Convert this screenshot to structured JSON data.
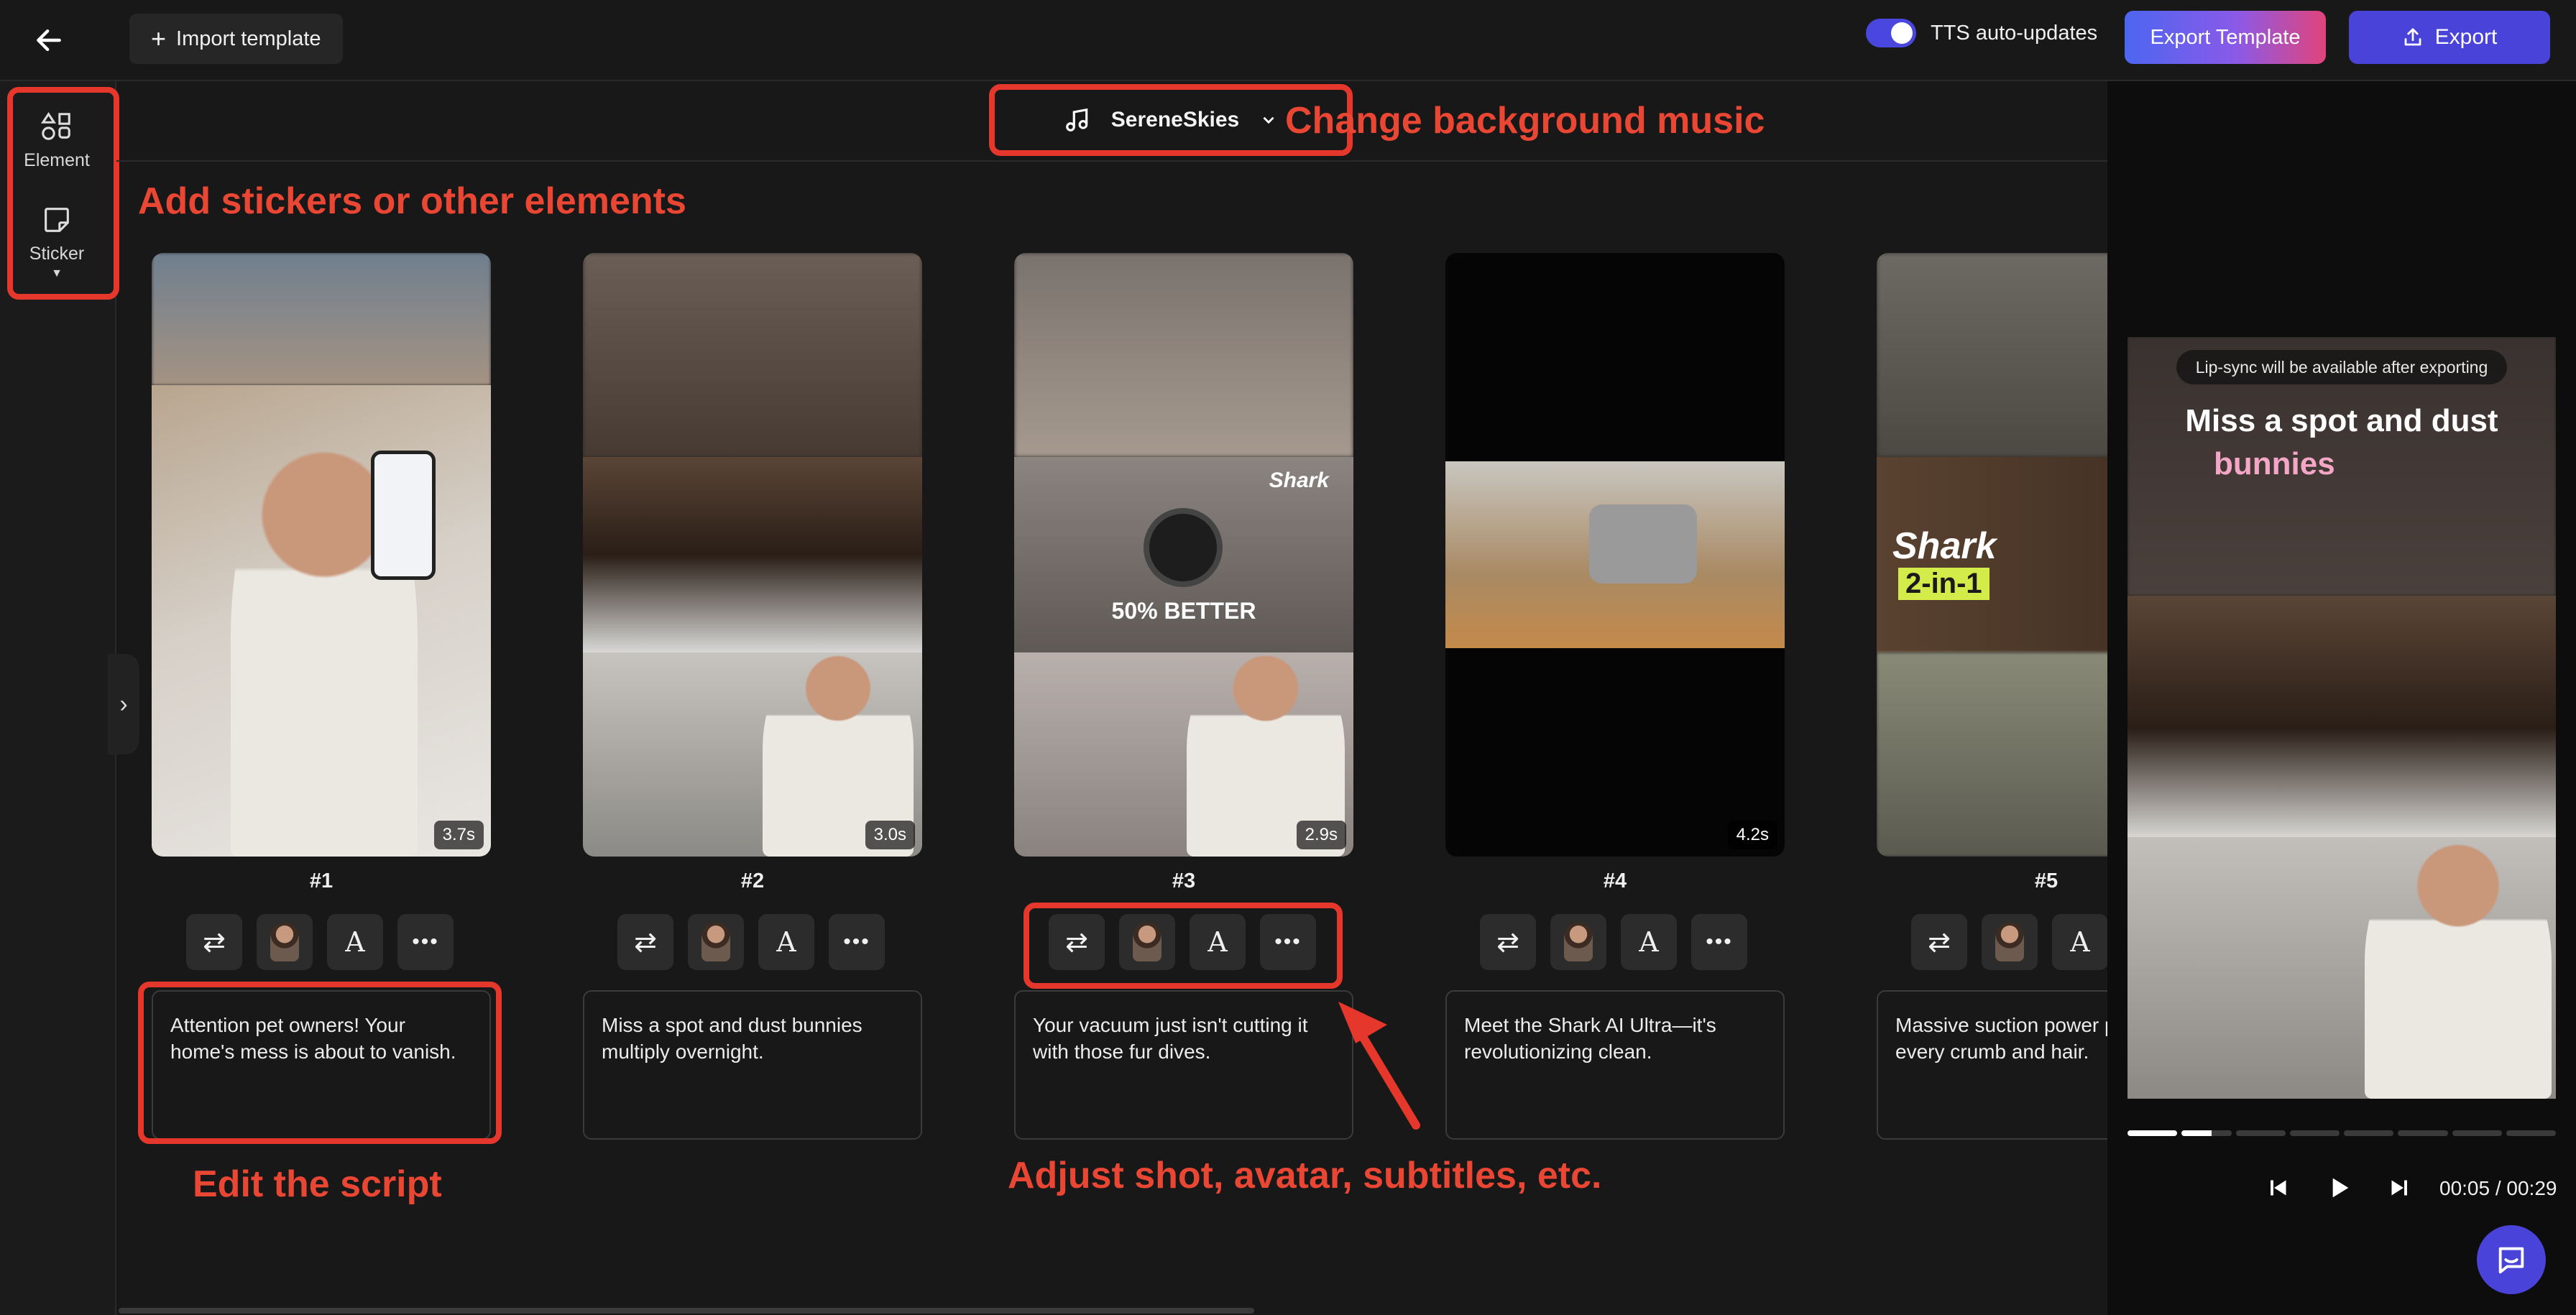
{
  "topbar": {
    "import_label": "Import template",
    "tts_label": "TTS auto-updates",
    "export_template_label": "Export Template",
    "export_label": "Export"
  },
  "sidebar": {
    "items": [
      {
        "label": "Element",
        "icon": "shapes-icon"
      },
      {
        "label": "Sticker",
        "icon": "sticker-icon"
      }
    ]
  },
  "music": {
    "track": "SereneSkies"
  },
  "annotations": {
    "music": "Change background music",
    "stickers": "Add stickers or other elements",
    "script": "Edit the script",
    "adjust": "Adjust shot, avatar, subtitles, etc."
  },
  "shots": [
    {
      "number": "#1",
      "duration": "3.7s",
      "script": "Attention pet owners! Your home's mess is about to vanish."
    },
    {
      "number": "#2",
      "duration": "3.0s",
      "script": "Miss a spot and dust bunnies multiply overnight."
    },
    {
      "number": "#3",
      "duration": "2.9s",
      "script": "Your vacuum just isn't cutting it with those fur dives.",
      "overlay_brand": "Shark",
      "overlay_text": "50% BETTER"
    },
    {
      "number": "#4",
      "duration": "4.2s",
      "script": "Meet the Shark AI Ultra—it's revolutionizing clean."
    },
    {
      "number": "#5",
      "duration": "",
      "script": "Massive suction power picks up every crumb and hair.",
      "overlay_brand": "Shark",
      "overlay_text": "2-in-1"
    }
  ],
  "preview": {
    "lipsync_notice": "Lip-sync will be available after exporting",
    "caption_line1": "Miss a spot and dust",
    "caption_line2": "bunnies",
    "time": "00:05 / 00:29",
    "progress": 0.17
  }
}
